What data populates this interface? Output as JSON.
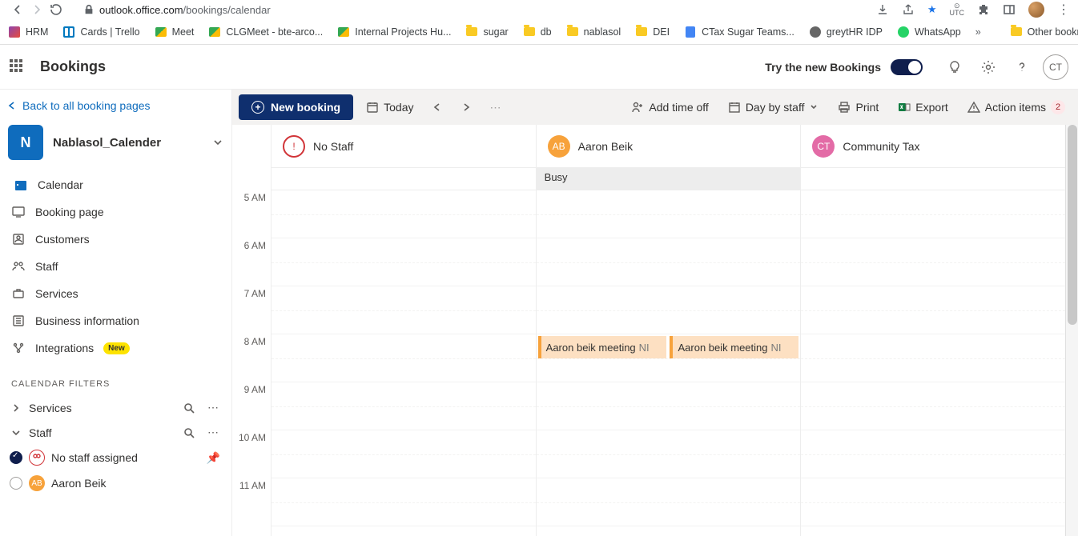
{
  "browser": {
    "url_domain": "outlook.office.com",
    "url_path": "/bookings/calendar",
    "bookmarks": [
      {
        "label": "HRM",
        "icon": "hrm"
      },
      {
        "label": "Cards | Trello",
        "icon": "trello"
      },
      {
        "label": "Meet",
        "icon": "meet"
      },
      {
        "label": "CLGMeet - bte-arco...",
        "icon": "meet"
      },
      {
        "label": "Internal Projects Hu...",
        "icon": "meet"
      },
      {
        "label": "sugar",
        "icon": "folder"
      },
      {
        "label": "db",
        "icon": "folder"
      },
      {
        "label": "nablasol",
        "icon": "folder"
      },
      {
        "label": "DEI",
        "icon": "folder"
      },
      {
        "label": "CTax Sugar Teams...",
        "icon": "doc"
      },
      {
        "label": "greytHR IDP",
        "icon": "greyt"
      },
      {
        "label": "WhatsApp",
        "icon": "wa"
      }
    ],
    "other_bookmarks": "Other bookmarks"
  },
  "header": {
    "app_title": "Bookings",
    "try_new": "Try the new Bookings",
    "profile_initials": "CT"
  },
  "sidebar": {
    "back_label": "Back to all booking pages",
    "calendar_name": "Nablasol_Calender",
    "calendar_initial": "N",
    "nav": [
      {
        "label": "Calendar",
        "icon": "calendar",
        "active": true
      },
      {
        "label": "Booking page",
        "icon": "monitor"
      },
      {
        "label": "Customers",
        "icon": "customers"
      },
      {
        "label": "Staff",
        "icon": "staff"
      },
      {
        "label": "Services",
        "icon": "services"
      },
      {
        "label": "Business information",
        "icon": "biz"
      },
      {
        "label": "Integrations",
        "icon": "integrations",
        "badge": "New"
      }
    ],
    "filters_header": "CALENDAR FILTERS",
    "filters": [
      {
        "label": "Services",
        "chev": "right"
      },
      {
        "label": "Staff",
        "chev": "down"
      }
    ],
    "staff_filters": [
      {
        "label": "No staff assigned",
        "checked": true,
        "av_bg": "none"
      },
      {
        "label": "Aaron Beik",
        "checked": false,
        "av_bg": "#f7a23b",
        "av_text": "AB"
      }
    ]
  },
  "commandbar": {
    "new_booking": "New booking",
    "today": "Today",
    "add_time_off": "Add time off",
    "day_by_staff": "Day by staff",
    "print": "Print",
    "export": "Export",
    "action_items": "Action items",
    "action_count": "2"
  },
  "calendar": {
    "hours": [
      "5 AM",
      "6 AM",
      "7 AM",
      "8 AM",
      "9 AM",
      "10 AM",
      "11 AM"
    ],
    "columns": [
      {
        "title": "No Staff",
        "type": "nostaff",
        "av_bg": "transparent"
      },
      {
        "title": "Aaron Beik",
        "type": "staff",
        "av_bg": "#f7a23b",
        "av_text": "AB",
        "allday": "Busy",
        "events": [
          {
            "title": "Aaron beik meeting",
            "sub": "NI",
            "slot": "8am",
            "half": 0
          },
          {
            "title": "Aaron beik meeting",
            "sub": "NI",
            "slot": "8am",
            "half": 1
          }
        ]
      },
      {
        "title": "Community Tax",
        "type": "staff",
        "av_bg": "#e36ba6",
        "av_text": "CT"
      }
    ]
  }
}
